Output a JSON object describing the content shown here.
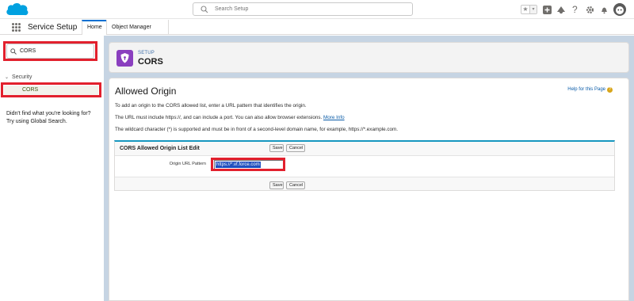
{
  "header": {
    "search_placeholder": "Search Setup",
    "icons": [
      "star-icon",
      "chevron-down-icon",
      "plus-icon",
      "trailhead-icon",
      "help-icon",
      "gear-icon",
      "bell-icon",
      "avatar"
    ]
  },
  "nav": {
    "app_name": "Service Setup",
    "tabs": [
      {
        "label": "Home",
        "active": true
      },
      {
        "label": "Object Manager",
        "active": false
      }
    ]
  },
  "sidebar": {
    "quick_find_value": "CORS",
    "section": "Security",
    "item": "CORS",
    "help_line1": "Didn't find what you're looking for?",
    "help_line2": "Try using Global Search."
  },
  "setup_header": {
    "kicker": "SETUP",
    "title": "CORS"
  },
  "main": {
    "title": "Allowed Origin",
    "help_link": "Help for this Page",
    "para1": "To add an origin to the CORS allowed list, enter a URL pattern that identifies the origin.",
    "para2": "The URL must include https://, and can include a port. You can also allow browser extensions.",
    "para2_link": "More Info",
    "para3": "The wildcard character (*) is supported and must be in front of a second-level domain name, for example, https://*.example.com.",
    "block": {
      "title": "CORS Allowed Origin List Edit",
      "save_label": "Save",
      "cancel_label": "Cancel",
      "field_label": "Origin URL Pattern",
      "field_value": "https://*.vf.force.com"
    }
  },
  "colors": {
    "accent": "#0070d2",
    "highlight": "#e2202d",
    "setup_icon": "#8a3fbf",
    "page_bg": "#c6d4e3"
  }
}
